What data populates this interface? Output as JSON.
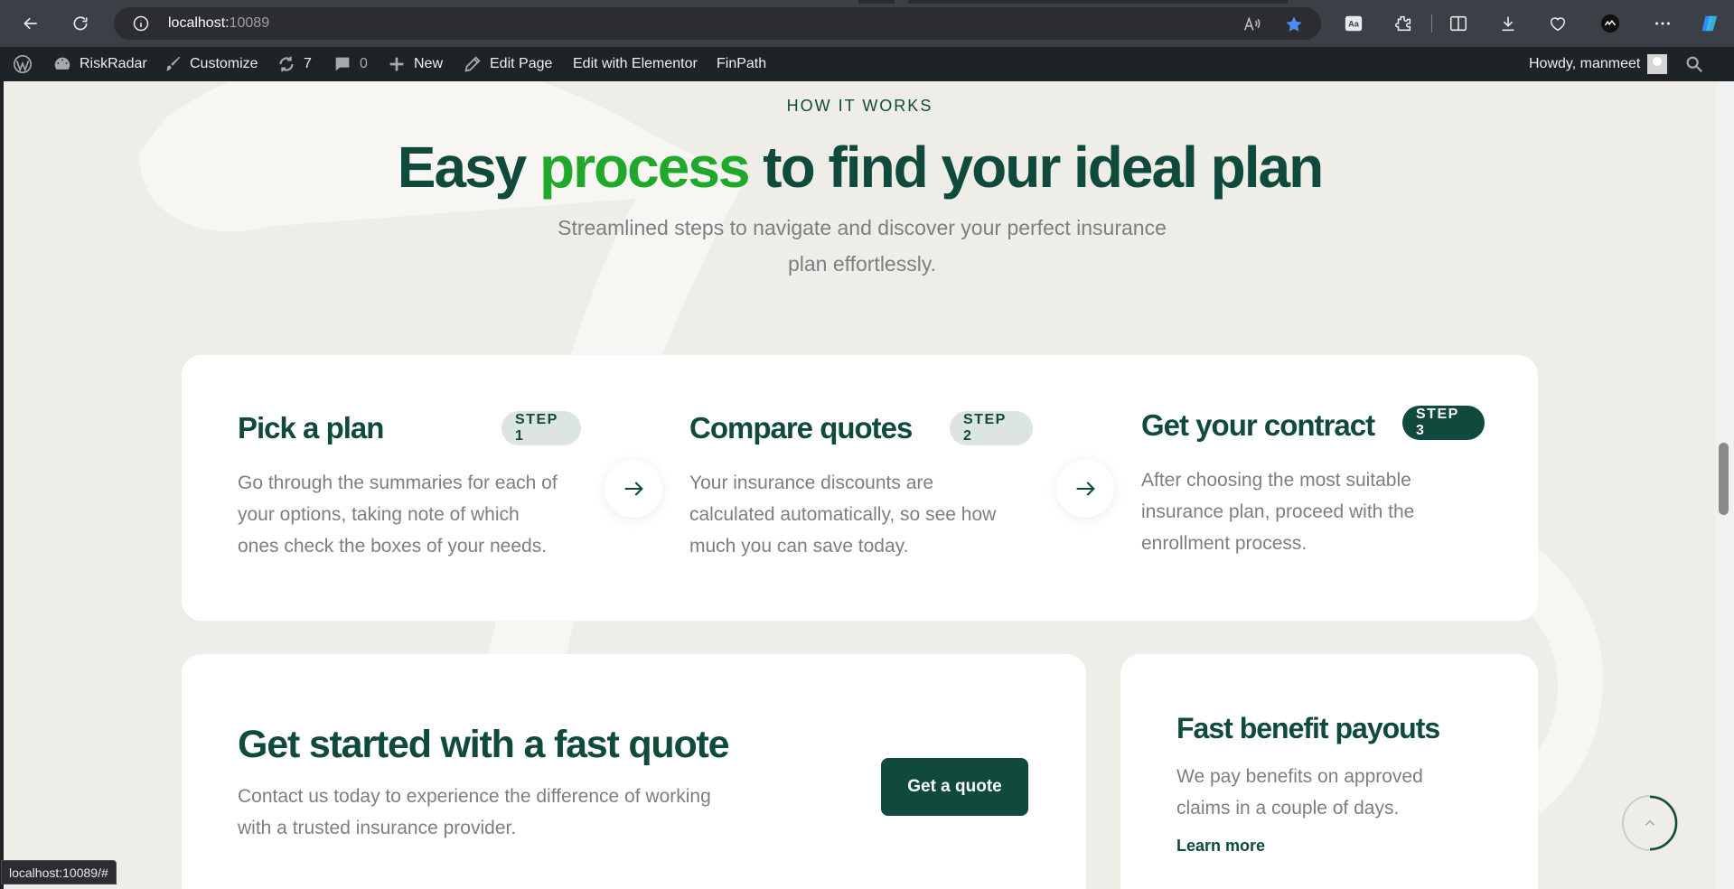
{
  "browser": {
    "url_host": "localhost:",
    "url_port": "10089"
  },
  "admin_bar": {
    "site_name": "RiskRadar",
    "customize": "Customize",
    "updates_count": "7",
    "comments_count": "0",
    "new": "New",
    "edit_page": "Edit Page",
    "edit_elementor": "Edit with Elementor",
    "finpath": "FinPath",
    "howdy": "Howdy, manmeet"
  },
  "section": {
    "eyebrow": "HOW IT WORKS",
    "headline_pre": "Easy ",
    "headline_accent": "process",
    "headline_post": " to find your ideal plan",
    "subline": "Streamlined steps to navigate and discover your perfect insurance plan effortlessly."
  },
  "steps": [
    {
      "title": "Pick a plan",
      "badge": "STEP 1",
      "text": "Go through the summaries for each of your options, taking note of which ones check the boxes of your needs."
    },
    {
      "title": "Compare quotes",
      "badge": "STEP 2",
      "text": "Your insurance discounts are calculated automatically, so see how much you can save today."
    },
    {
      "title": "Get your contract",
      "badge": "STEP 3",
      "text": "After choosing the most suitable insurance plan, proceed with the enrollment process."
    }
  ],
  "quote": {
    "title": "Get started with a fast quote",
    "text": "Contact us today to experience the difference of working with a trusted insurance provider.",
    "button": "Get a quote"
  },
  "payouts": {
    "title": "Fast benefit payouts",
    "text": "We pay benefits on approved claims in a couple of days.",
    "link": "Learn more"
  },
  "status_bar": "localhost:10089/#",
  "colors": {
    "brand_dark": "#0f4a3c",
    "accent_green": "#1fa82a",
    "page_bg": "#efede8"
  }
}
